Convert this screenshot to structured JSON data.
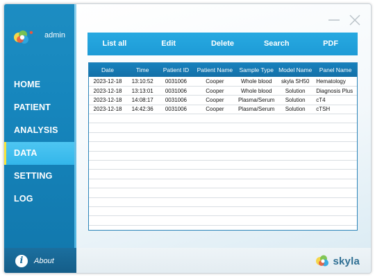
{
  "user": {
    "name": "admin",
    "logo": "skyla-logo"
  },
  "nav": {
    "items": [
      {
        "label": "HOME"
      },
      {
        "label": "PATIENT"
      },
      {
        "label": "ANALYSIS"
      },
      {
        "label": "DATA",
        "active": true
      },
      {
        "label": "SETTING"
      },
      {
        "label": "LOG"
      }
    ]
  },
  "about": {
    "label": "About",
    "icon": "info-icon"
  },
  "window_controls": {
    "minimize_icon": "minimize-icon",
    "close_icon": "close-icon"
  },
  "toolbar": {
    "list_all": "List all",
    "edit": "Edit",
    "delete": "Delete",
    "search": "Search",
    "pdf": "PDF"
  },
  "table": {
    "columns": [
      "Date",
      "Time",
      "Patient ID",
      "Patient Name",
      "Sample Type",
      "Model Name",
      "Panel Name"
    ],
    "rows": [
      [
        "2023-12-18",
        "13:10:52",
        "0031006",
        "Cooper",
        "Whole blood",
        "skyla SH50",
        "Hematology"
      ],
      [
        "2023-12-18",
        "13:13:01",
        "0031006",
        "Cooper",
        "Whole blood",
        "Solution",
        "Diagnosis Plus"
      ],
      [
        "2023-12-18",
        "14:08:17",
        "0031006",
        "Cooper",
        "Plasma/Serum",
        "Solution",
        "cT4"
      ],
      [
        "2023-12-18",
        "14:42:36",
        "0031006",
        "Cooper",
        "Plasma/Serum",
        "Solution",
        "cTSH"
      ]
    ]
  },
  "brand": {
    "name": "skyla",
    "icon": "skyla-logo"
  },
  "colors": {
    "sidebar": "#1686bd",
    "active_nav": "#33b6ea",
    "active_marker": "#f4e23c",
    "toolbar": "#1e9bd6",
    "table_header": "#1781bd"
  }
}
